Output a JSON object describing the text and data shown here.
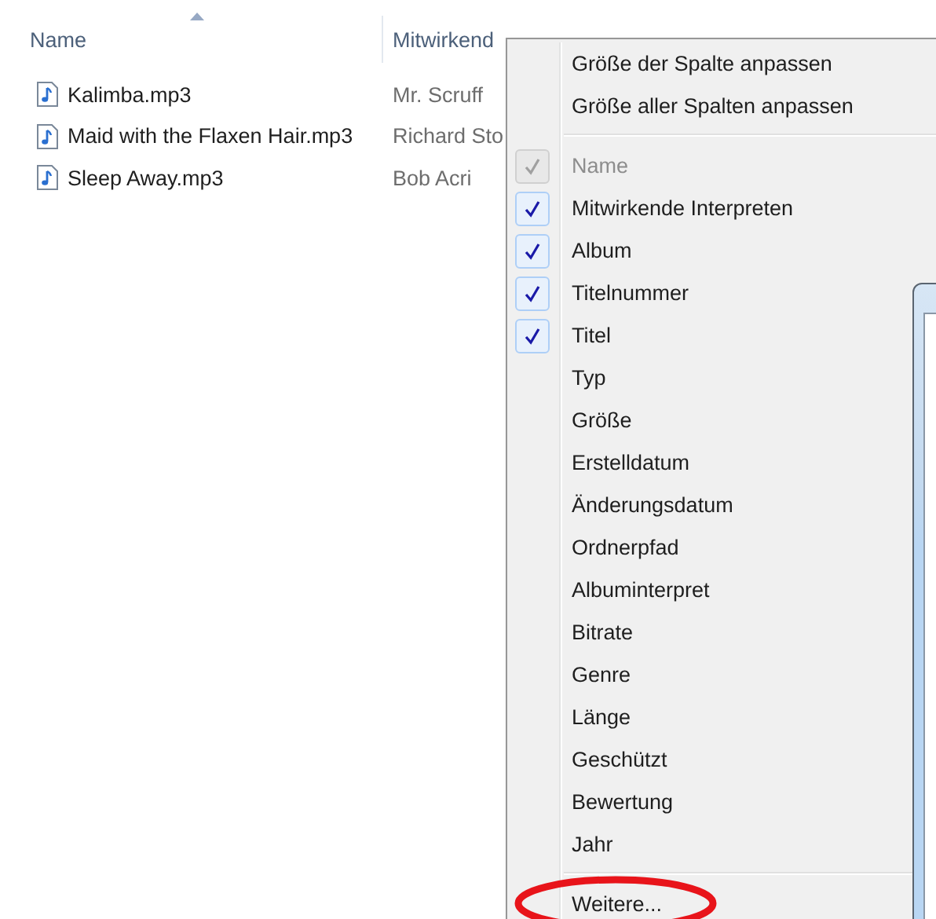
{
  "file_list": {
    "columns": [
      {
        "label": "Name",
        "sorted": true
      },
      {
        "label": "Mitwirkend",
        "sorted": false
      }
    ],
    "rows": [
      {
        "name": "Kalimba.mp3",
        "artist": "Mr. Scruff"
      },
      {
        "name": "Maid with the Flaxen Hair.mp3",
        "artist": "Richard Sto"
      },
      {
        "name": "Sleep Away.mp3",
        "artist": "Bob Acri"
      }
    ]
  },
  "context_menu": {
    "actions": [
      "Größe der Spalte anpassen",
      "Größe aller Spalten anpassen"
    ],
    "columns": [
      {
        "label": "Name",
        "checked": true,
        "disabled": true
      },
      {
        "label": "Mitwirkende Interpreten",
        "checked": true,
        "disabled": false
      },
      {
        "label": "Album",
        "checked": true,
        "disabled": false
      },
      {
        "label": "Titelnummer",
        "checked": true,
        "disabled": false
      },
      {
        "label": "Titel",
        "checked": true,
        "disabled": false
      },
      {
        "label": "Typ",
        "checked": false,
        "disabled": false
      },
      {
        "label": "Größe",
        "checked": false,
        "disabled": false
      },
      {
        "label": "Erstelldatum",
        "checked": false,
        "disabled": false
      },
      {
        "label": "Änderungsdatum",
        "checked": false,
        "disabled": false
      },
      {
        "label": "Ordnerpfad",
        "checked": false,
        "disabled": false
      },
      {
        "label": "Albuminterpret",
        "checked": false,
        "disabled": false
      },
      {
        "label": "Bitrate",
        "checked": false,
        "disabled": false
      },
      {
        "label": "Genre",
        "checked": false,
        "disabled": false
      },
      {
        "label": "Länge",
        "checked": false,
        "disabled": false
      },
      {
        "label": "Geschützt",
        "checked": false,
        "disabled": false
      },
      {
        "label": "Bewertung",
        "checked": false,
        "disabled": false
      },
      {
        "label": "Jahr",
        "checked": false,
        "disabled": false
      }
    ],
    "more": {
      "label": "Weitere...",
      "highlighted": true
    }
  }
}
